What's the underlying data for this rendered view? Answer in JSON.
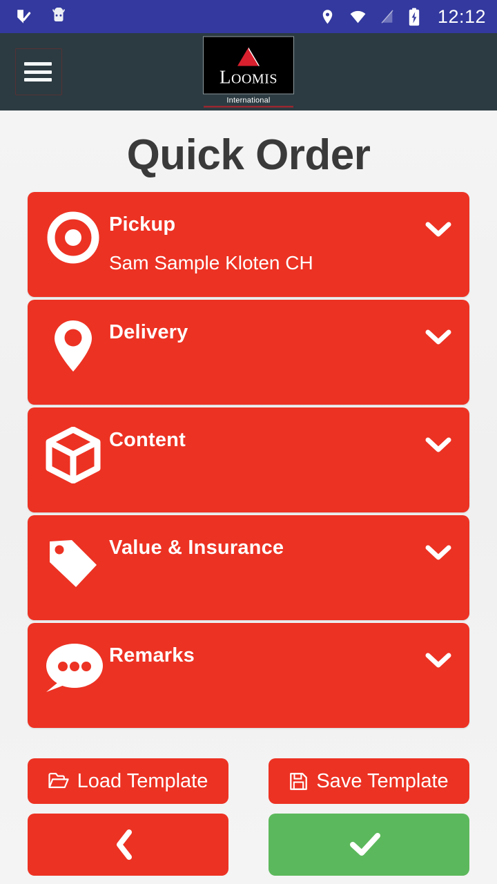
{
  "statusbar": {
    "time": "12:12",
    "left_icons": [
      "checkbox-badge-icon",
      "android-robot-icon"
    ],
    "right_icons": [
      "location-icon",
      "wifi-icon",
      "no-sim-icon",
      "battery-charging-icon"
    ],
    "background_color": "#33399e"
  },
  "appbar": {
    "menu_icon": "hamburger-menu-icon",
    "logo": {
      "wordmark": "LOOMIS",
      "wordmark_first": "L",
      "wordmark_rest": "OOMIS",
      "subtitle": "International",
      "accent_color": "#b2232b"
    },
    "background_color": "#2c3b41"
  },
  "page": {
    "title": "Quick Order",
    "accent_color": "#ec3223",
    "confirm_color": "#5cb85c",
    "background_color": "#f2f2f2"
  },
  "cards": [
    {
      "name": "pickup",
      "title": "Pickup",
      "subtitle": "Sam Sample Kloten CH",
      "icon": "target-radio-icon",
      "chevron": "chevron-down-icon"
    },
    {
      "name": "delivery",
      "title": "Delivery",
      "subtitle": "",
      "icon": "map-pin-icon",
      "chevron": "chevron-down-icon"
    },
    {
      "name": "content",
      "title": "Content",
      "subtitle": "",
      "icon": "box-cube-icon",
      "chevron": "chevron-down-icon"
    },
    {
      "name": "value-insurance",
      "title": "Value & Insurance",
      "subtitle": "",
      "icon": "price-tag-icon",
      "chevron": "chevron-down-icon"
    },
    {
      "name": "remarks",
      "title": "Remarks",
      "subtitle": "",
      "icon": "speech-bubble-icon",
      "chevron": "chevron-down-icon"
    }
  ],
  "buttons": {
    "load_template": {
      "label": "Load Template",
      "icon": "open-folder-icon"
    },
    "save_template": {
      "label": "Save Template",
      "icon": "floppy-save-icon"
    },
    "back": {
      "label": "",
      "icon": "chevron-left-icon"
    },
    "confirm": {
      "label": "",
      "icon": "check-icon"
    }
  }
}
